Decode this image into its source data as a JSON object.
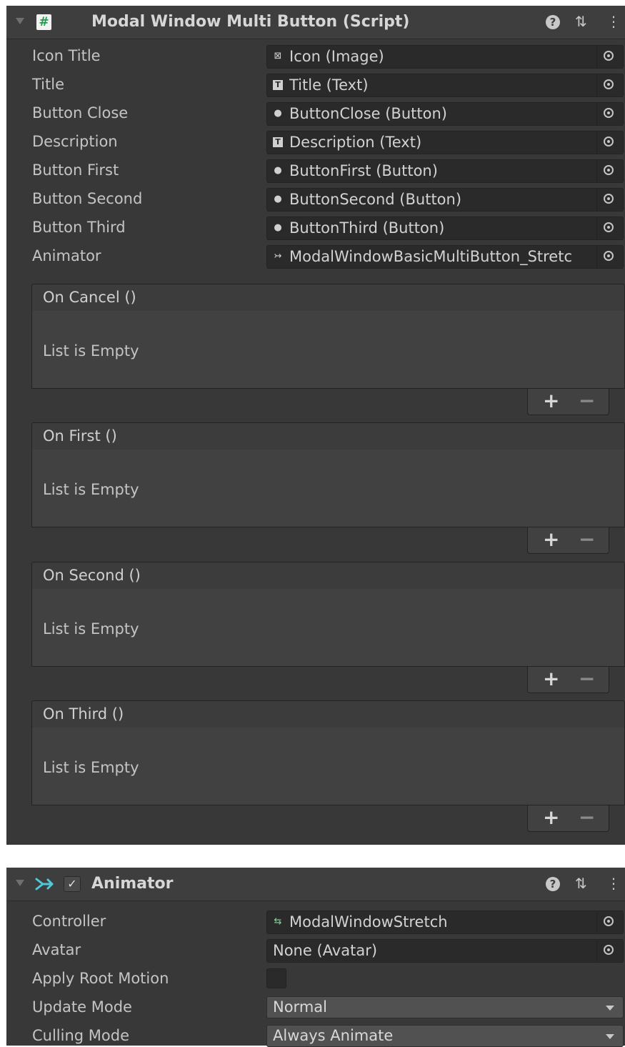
{
  "component1": {
    "title": "Modal Window Multi Button (Script)",
    "icon": "script-icon",
    "properties": [
      {
        "label": "Icon Title",
        "value": "Icon (Image)",
        "icon": "image-icon"
      },
      {
        "label": "Title",
        "value": "Title (Text)",
        "icon": "text-icon"
      },
      {
        "label": "Button Close",
        "value": "ButtonClose (Button)",
        "icon": "button-icon"
      },
      {
        "label": "Description",
        "value": "Description (Text)",
        "icon": "text-icon"
      },
      {
        "label": "Button First",
        "value": "ButtonFirst (Button)",
        "icon": "button-icon"
      },
      {
        "label": "Button Second",
        "value": "ButtonSecond (Button)",
        "icon": "button-icon"
      },
      {
        "label": "Button Third",
        "value": "ButtonThird (Button)",
        "icon": "button-icon"
      },
      {
        "label": "Animator",
        "value": "ModalWindowBasicMultiButton_Stretc",
        "icon": "animator-icon"
      }
    ],
    "events": [
      {
        "title": "On Cancel ()",
        "empty_text": "List is Empty"
      },
      {
        "title": "On First ()",
        "empty_text": "List is Empty"
      },
      {
        "title": "On Second ()",
        "empty_text": "List is Empty"
      },
      {
        "title": "On Third ()",
        "empty_text": "List is Empty"
      }
    ],
    "add_label": "+",
    "remove_label": "−"
  },
  "component2": {
    "title": "Animator",
    "enabled": true,
    "check_glyph": "✓",
    "properties": [
      {
        "label": "Controller",
        "value": "ModalWindowStretch",
        "icon": "animator-controller-icon"
      },
      {
        "label": "Avatar",
        "value": "None (Avatar)"
      },
      {
        "label": "Apply Root Motion",
        "value": false
      },
      {
        "label": "Update Mode",
        "value": "Normal"
      },
      {
        "label": "Culling Mode",
        "value": "Always Animate"
      }
    ]
  },
  "header_buttons": {
    "help": "?",
    "settings": "⇅",
    "more": "⋮"
  },
  "colors": {
    "panel_bg": "#383838",
    "header_bg": "#3e3e3e",
    "field_bg": "#2a2a2a",
    "script_accent": "#1c9e4c",
    "animator_accent": "#4fc8d8"
  }
}
